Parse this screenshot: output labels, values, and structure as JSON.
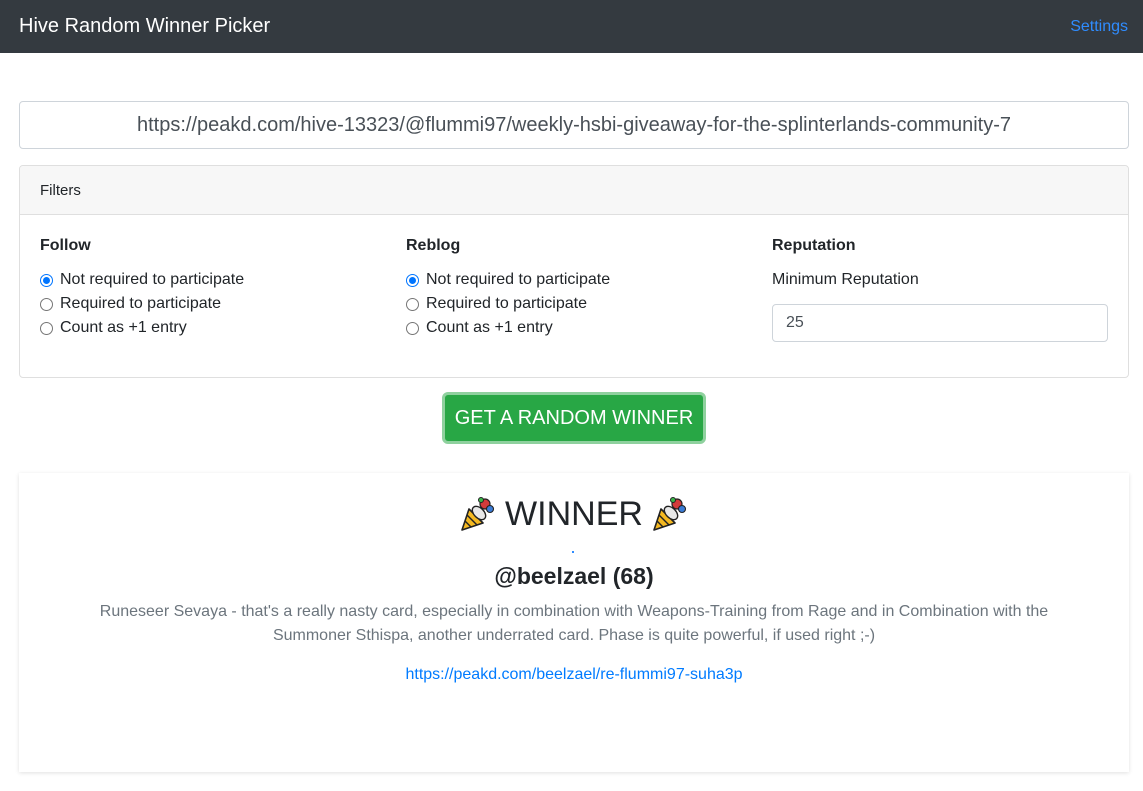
{
  "navbar": {
    "brand": "Hive Random Winner Picker",
    "settings_label": "Settings"
  },
  "post_url": {
    "value": "https://peakd.com/hive-13323/@flummi97/weekly-hsbi-giveaway-for-the-splinterlands-community-7"
  },
  "filters": {
    "title": "Filters",
    "follow": {
      "title": "Follow",
      "options": [
        "Not required to participate",
        "Required to participate",
        "Count as +1 entry"
      ],
      "selected": 0
    },
    "reblog": {
      "title": "Reblog",
      "options": [
        "Not required to participate",
        "Required to participate",
        "Count as +1 entry"
      ],
      "selected": 0
    },
    "reputation": {
      "title": "Reputation",
      "label": "Minimum Reputation",
      "value": "25"
    }
  },
  "action": {
    "button_label": "GET A RANDOM WINNER"
  },
  "winner": {
    "heading": "WINNER",
    "icon": "party-popper-icon",
    "name": "@beelzael (68)",
    "comment": "Runeseer Sevaya - that's a really nasty card, especially in combination with Weapons-Training from Rage and in Combination with the Summoner Sthispa, another underrated card. Phase is quite powerful, if used right ;-)",
    "link": "https://peakd.com/beelzael/re-flummi97-suha3p"
  },
  "colors": {
    "navbar_bg": "#343a40",
    "accent_link": "#007bff",
    "success_button": "#28a745",
    "radio_checked": "#0075ff"
  }
}
